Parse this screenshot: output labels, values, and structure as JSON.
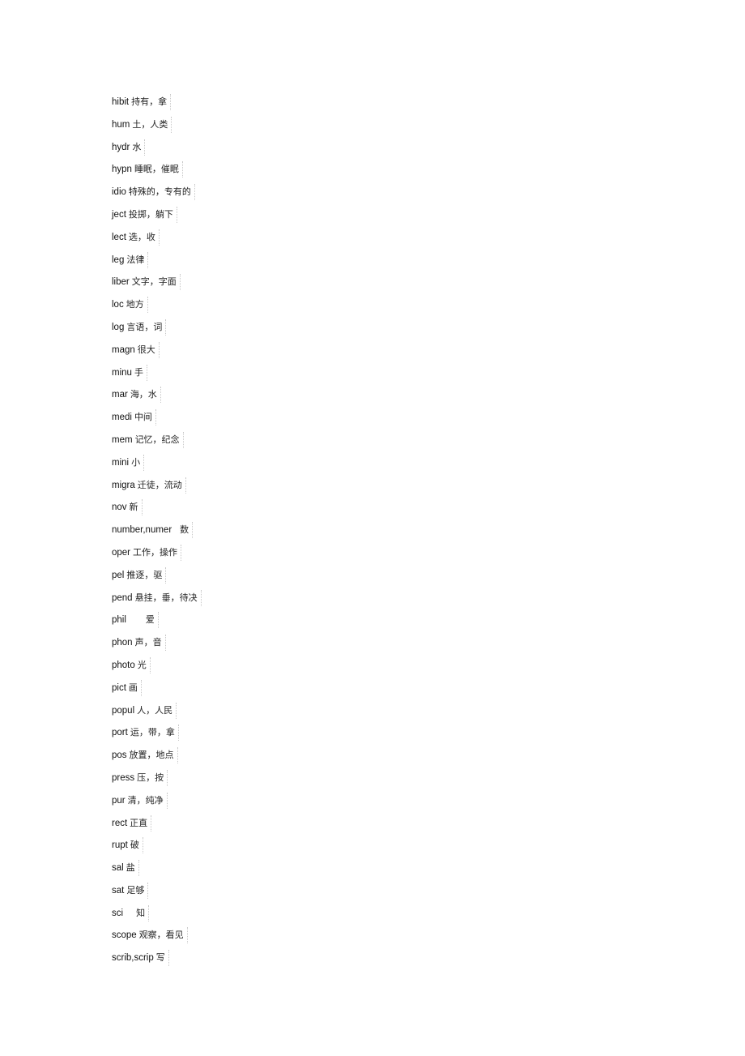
{
  "document": {
    "entries": [
      {
        "root": "hibit",
        "meaning": "持有，拿"
      },
      {
        "root": "hum",
        "meaning": "土，人类"
      },
      {
        "root": "hydr",
        "meaning": "水"
      },
      {
        "root": "hypn",
        "meaning": "睡眠，催眠"
      },
      {
        "root": "idio",
        "meaning": "特殊的，专有的"
      },
      {
        "root": "ject",
        "meaning": "投掷，躺下"
      },
      {
        "root": "lect",
        "meaning": "选，收"
      },
      {
        "root": "leg",
        "meaning": "法律"
      },
      {
        "root": "liber",
        "meaning": "文字，字面"
      },
      {
        "root": "loc",
        "meaning": "地方"
      },
      {
        "root": "log",
        "meaning": "言语，词"
      },
      {
        "root": "magn",
        "meaning": "很大"
      },
      {
        "root": "minu",
        "meaning": "手"
      },
      {
        "root": "mar",
        "meaning": "海，水"
      },
      {
        "root": "medi",
        "meaning": "中间"
      },
      {
        "root": "mem",
        "meaning": "记忆，纪念"
      },
      {
        "root": "mini",
        "meaning": "小"
      },
      {
        "root": "migra",
        "meaning": "迁徒，流动"
      },
      {
        "root": "nov",
        "meaning": "新"
      },
      {
        "root": "number,numer",
        "meaning": "数"
      },
      {
        "root": "oper",
        "meaning": "工作，操作"
      },
      {
        "root": "pel",
        "meaning": "推逐，驱"
      },
      {
        "root": "pend",
        "meaning": "悬挂，垂，待决"
      },
      {
        "root": "phil",
        "meaning": "爱"
      },
      {
        "root": "phon",
        "meaning": "声，音"
      },
      {
        "root": "photo",
        "meaning": "光"
      },
      {
        "root": "pict",
        "meaning": "画"
      },
      {
        "root": "popul",
        "meaning": "人，人民"
      },
      {
        "root": "port",
        "meaning": "运，带，拿"
      },
      {
        "root": "pos",
        "meaning": "放置，地点"
      },
      {
        "root": "press",
        "meaning": "压，按"
      },
      {
        "root": "pur",
        "meaning": "清，纯净"
      },
      {
        "root": "rect",
        "meaning": "正直"
      },
      {
        "root": "rupt",
        "meaning": "破"
      },
      {
        "root": "sal",
        "meaning": "盐"
      },
      {
        "root": "sat",
        "meaning": "足够"
      },
      {
        "root": "sci",
        "meaning": "知"
      },
      {
        "root": "scope",
        "meaning": "观察，看见"
      },
      {
        "root": "scrib,scrip",
        "meaning": "写"
      }
    ]
  }
}
